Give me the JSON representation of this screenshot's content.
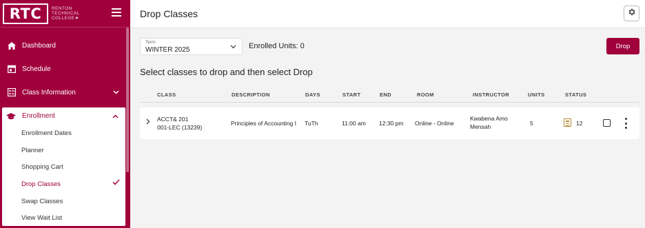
{
  "brand": {
    "logo": "RTC",
    "name_lines": [
      "RENTON",
      "TECHNICAL",
      "COLLEGE★"
    ],
    "accent": "#a0003c"
  },
  "nav": [
    {
      "label": "Dashboard",
      "icon": "home-icon"
    },
    {
      "label": "Schedule",
      "icon": "calendar-icon"
    },
    {
      "label": "Class Information",
      "icon": "list-icon",
      "chevron": "chevron-down"
    }
  ],
  "enrollment": {
    "label": "Enrollment",
    "icon": "graduation-cap-icon",
    "items": [
      "Enrollment Dates",
      "Planner",
      "Shopping Cart",
      "Drop Classes",
      "Swap Classes",
      "View Wait List"
    ],
    "active": "Drop Classes"
  },
  "header": {
    "title": "Drop Classes"
  },
  "term": {
    "label": "Term:",
    "value": "WINTER 2025"
  },
  "enrolled_units": "Enrolled Units: 0",
  "drop_button": "Drop",
  "instruction": "Select classes to drop and then select Drop",
  "columns": [
    "CLASS",
    "DESCRIPTION",
    "DAYS",
    "START",
    "END",
    "ROOM",
    "INSTRUCTOR",
    "UNITS",
    "STATUS"
  ],
  "rows": [
    {
      "class_line1": "ACCT& 201",
      "class_line2": "001-LEC (13239)",
      "description": "Principles of Accounting I",
      "days": "TuTh",
      "start": "11:00 am",
      "end": "12:30 pm",
      "room": "Online - Online",
      "instructor_line1": "Kwabena Amo",
      "instructor_line2": "Mensah",
      "units": "5",
      "status": "12"
    }
  ]
}
